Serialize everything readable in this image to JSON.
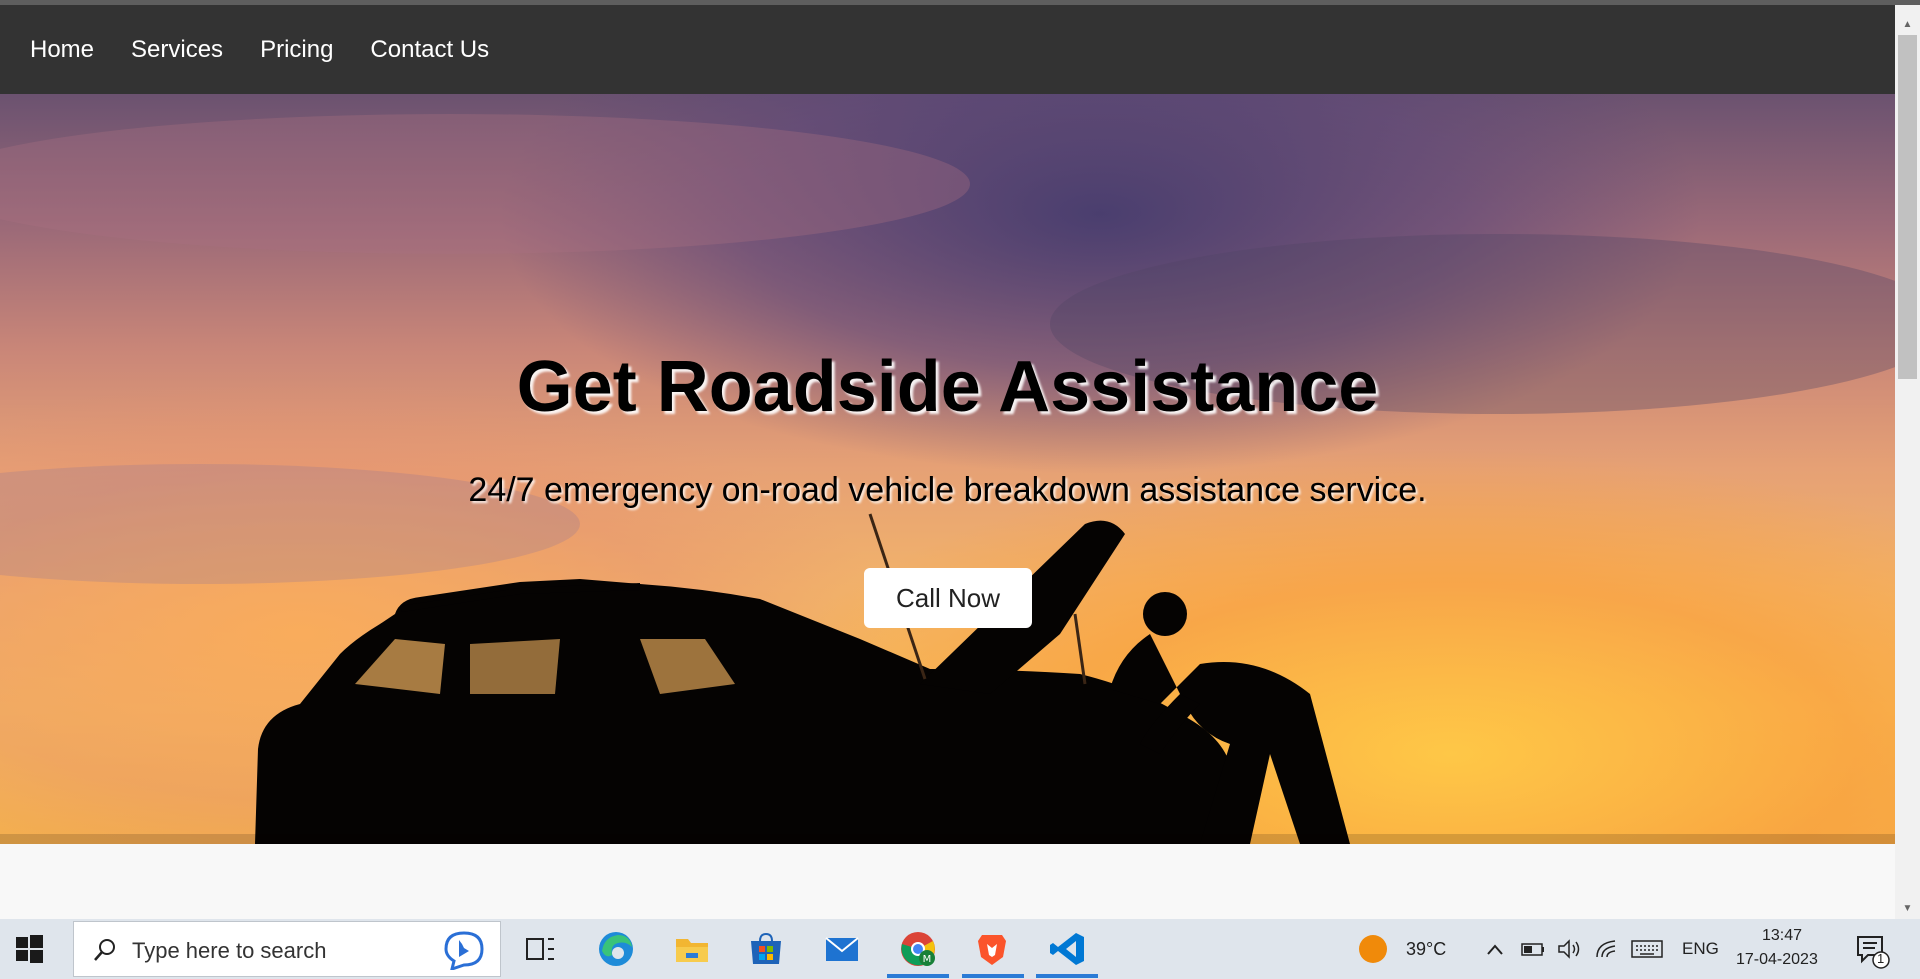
{
  "nav": {
    "links": [
      "Home",
      "Services",
      "Pricing",
      "Contact Us"
    ]
  },
  "hero": {
    "title": "Get Roadside Assistance",
    "subtitle": "24/7 emergency on-road vehicle breakdown assistance service.",
    "cta_label": "Call Now"
  },
  "taskbar": {
    "search_placeholder": "Type here to search",
    "apps": [
      "task-view",
      "edge",
      "file-explorer",
      "microsoft-store",
      "mail",
      "chrome",
      "brave",
      "vscode"
    ],
    "weather": "39°C",
    "language": "ENG",
    "time": "13:47",
    "date": "17-04-2023",
    "notification_count": "1"
  },
  "colors": {
    "navbar": "#333333",
    "nav_text": "#ffffff",
    "taskbar": "#dfe5ec",
    "accent": "#2b7bd6"
  }
}
